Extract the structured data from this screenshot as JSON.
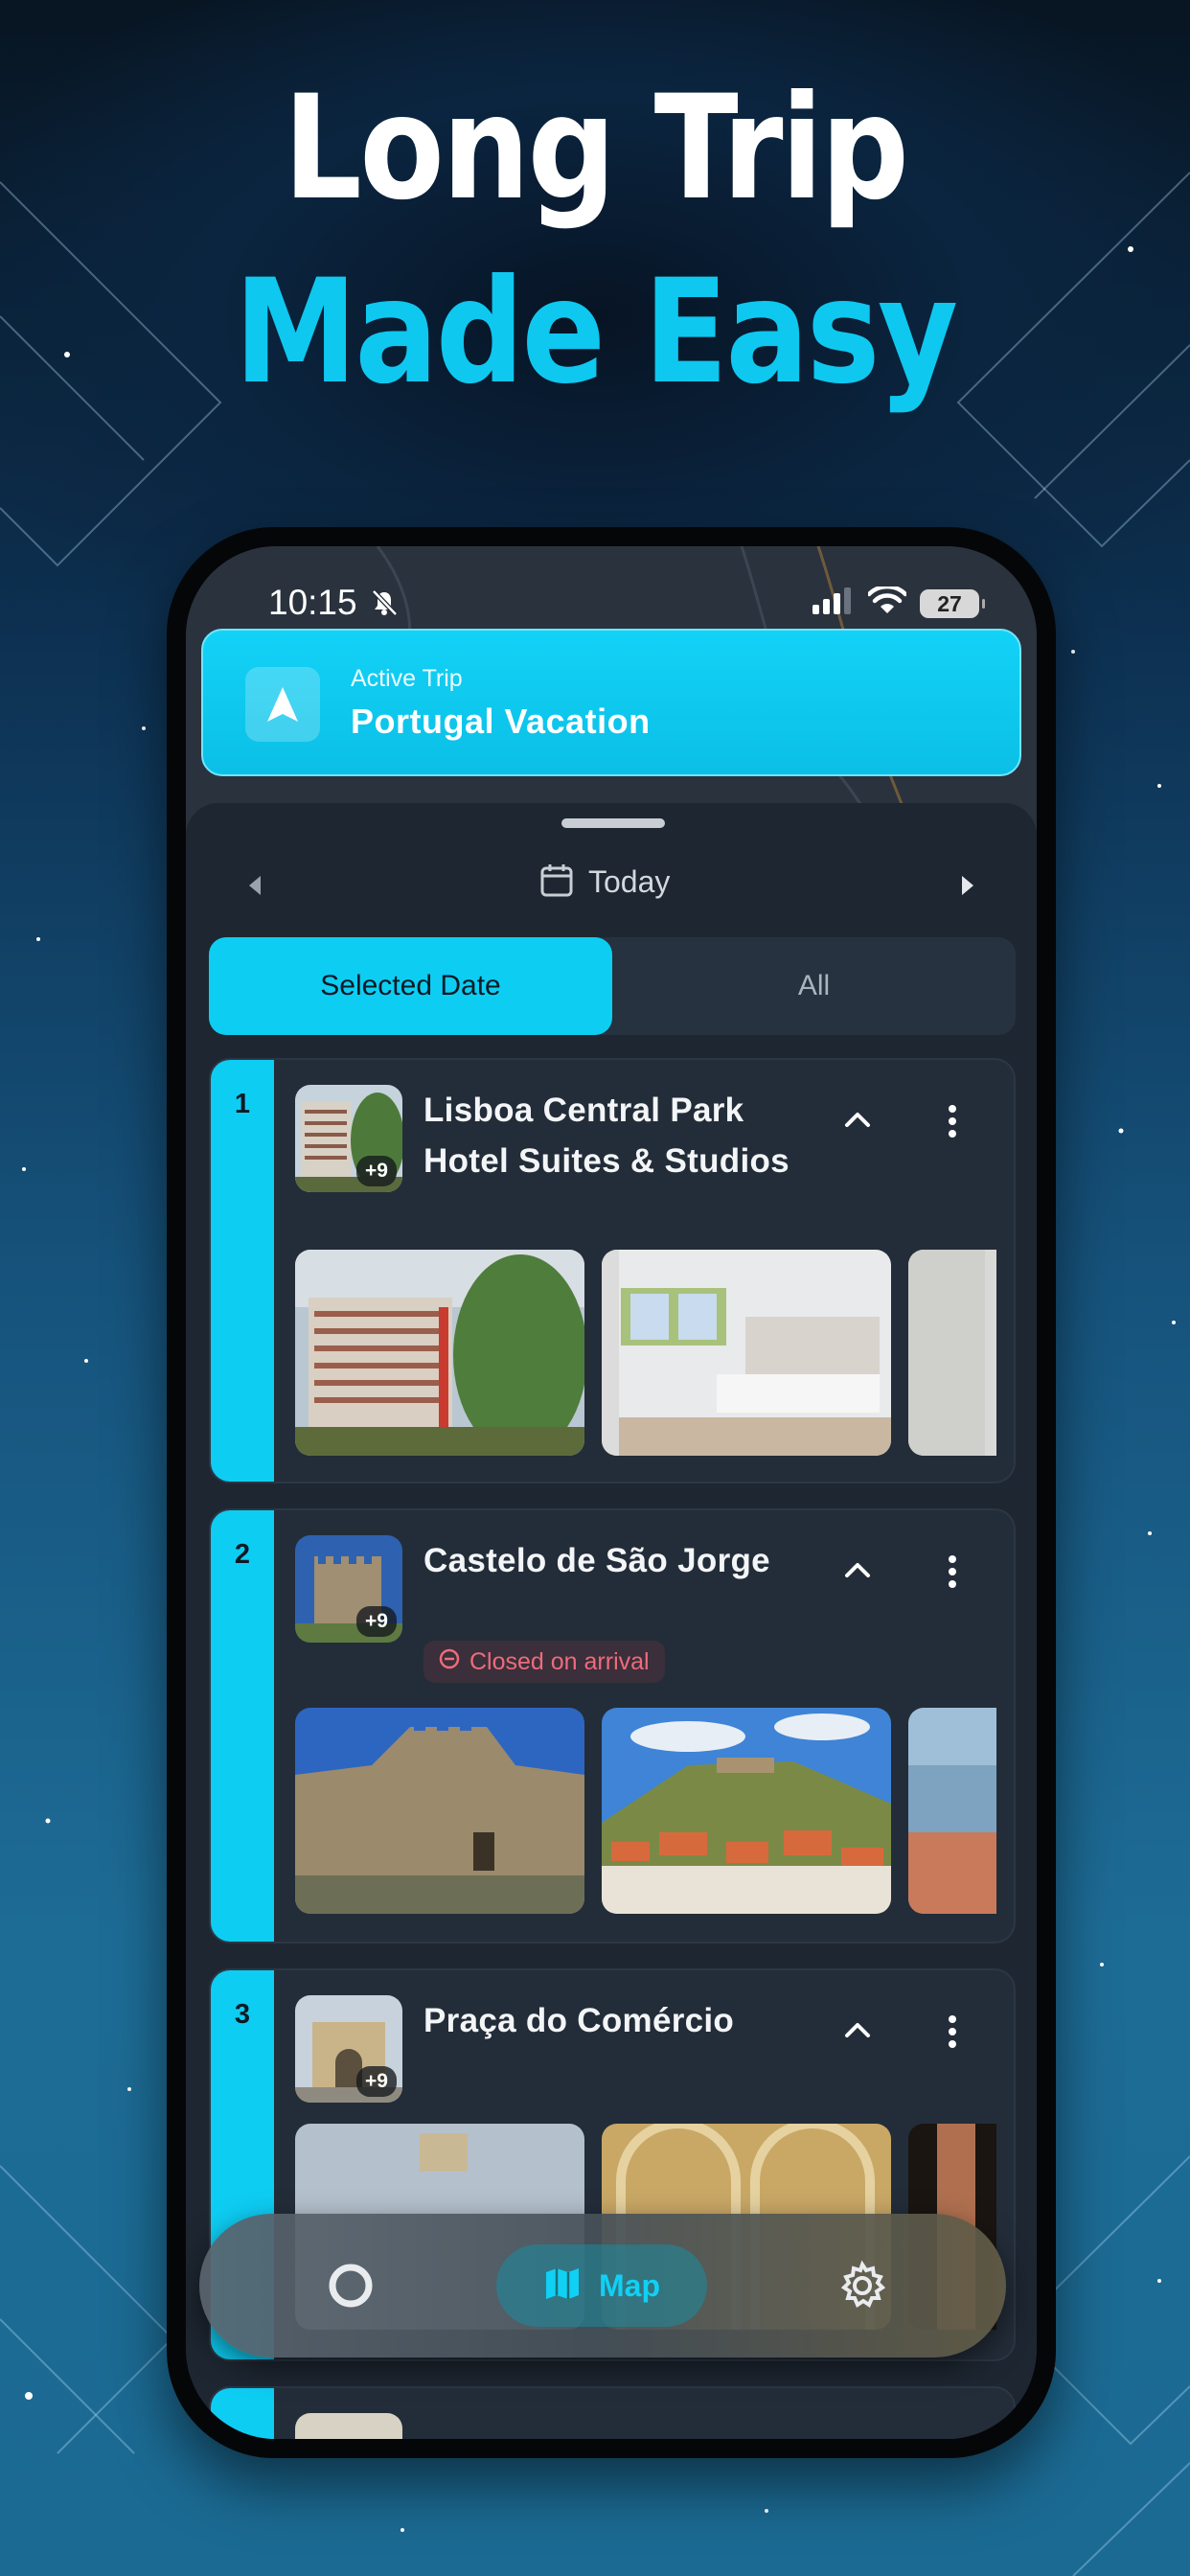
{
  "headline": {
    "line1": "Long Trip",
    "line2": "Made Easy"
  },
  "status_bar": {
    "time": "10:15",
    "battery": "27"
  },
  "active_trip": {
    "label": "Active Trip",
    "name": "Portugal Vacation"
  },
  "date_nav": {
    "date_label": "Today"
  },
  "segment": {
    "selected_label": "Selected Date",
    "all_label": "All",
    "active": "Selected Date"
  },
  "places": [
    {
      "number": "1",
      "title": "Lisboa Central Park Hotel Suites & Studios",
      "photo_count": "+9"
    },
    {
      "number": "2",
      "title": "Castelo de São Jorge",
      "photo_count": "+9",
      "status": "Closed on arrival"
    },
    {
      "number": "3",
      "title": "Praça do Comércio",
      "photo_count": "+9"
    }
  ],
  "bottom_nav": {
    "map_label": "Map",
    "active_tab": "Map"
  },
  "colors": {
    "accent": "#0ECDF3",
    "sheet": "#1D2631",
    "card": "#232D39",
    "closed_text": "#EE6B7C"
  },
  "icons": [
    "bell-slash-icon",
    "cellular-icon",
    "wifi-icon",
    "battery-icon",
    "navigation-arrow-icon",
    "chevron-left-icon",
    "calendar-icon",
    "chevron-right-icon",
    "chevron-up-icon",
    "more-vertical-icon",
    "minus-circle-icon",
    "home-circle-icon",
    "map-icon",
    "gear-icon"
  ]
}
